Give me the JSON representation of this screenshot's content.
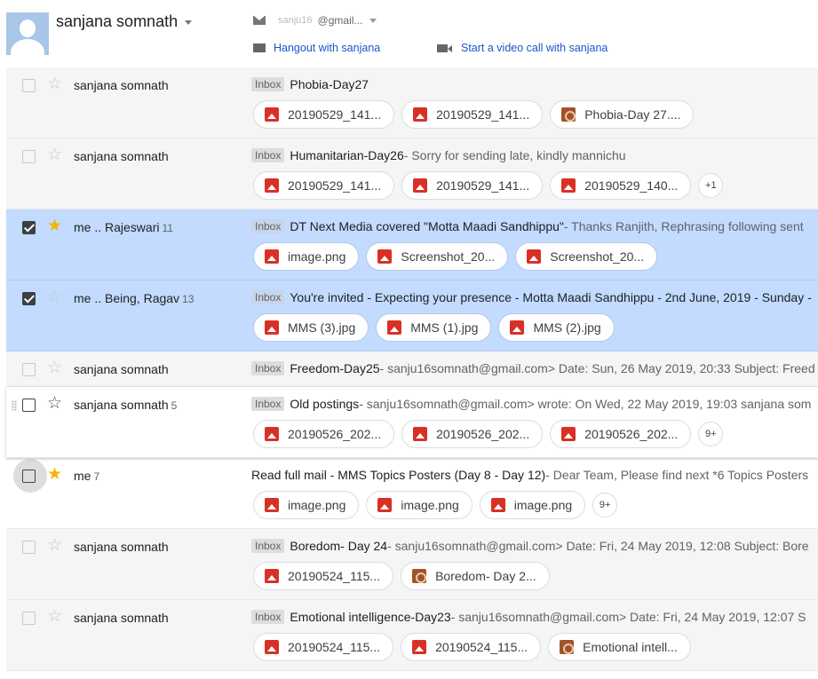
{
  "header": {
    "name": "sanjana somnath",
    "email_masked": "sanju16",
    "email_domain": "@gmail...",
    "hangout": "Hangout with sanjana",
    "video": "Start a video call with sanjana"
  },
  "rows": [
    {
      "sender": "sanjana somnath",
      "count": "",
      "label": "Inbox",
      "subject": "Phobia-Day27",
      "snippet": "",
      "chips": [
        "20190529_141...",
        "20190529_141...",
        "Phobia-Day 27...."
      ],
      "more": ""
    },
    {
      "sender": "sanjana somnath",
      "count": "",
      "label": "Inbox",
      "subject": "Humanitarian-Day26",
      "snippet": " - Sorry for sending late, kindly mannichu",
      "chips": [
        "20190529_141...",
        "20190529_141...",
        "20190529_140..."
      ],
      "more": "+1"
    },
    {
      "sender": "me .. Rajeswari",
      "count": "11",
      "label": "Inbox",
      "subject": "DT Next Media covered \"Motta Maadi Sandhippu\"",
      "snippet": " - Thanks Ranjith, Rephrasing following sent",
      "chips": [
        "image.png",
        "Screenshot_20...",
        "Screenshot_20..."
      ],
      "more": ""
    },
    {
      "sender": "me .. Being, Ragav",
      "count": "13",
      "label": "Inbox",
      "subject": "You're invited - Expecting your presence - Motta Maadi Sandhippu - 2nd June, 2019 - Sunday -",
      "snippet": "",
      "chips": [
        "MMS (3).jpg",
        "MMS (1).jpg",
        "MMS (2).jpg"
      ],
      "more": ""
    },
    {
      "sender": "sanjana somnath",
      "count": "",
      "label": "Inbox",
      "subject": "Freedom-Day25",
      "snippet": " - sanju16somnath@gmail.com> Date: Sun, 26 May 2019, 20:33 Subject: Freed",
      "chips": [],
      "more": ""
    },
    {
      "sender": "sanjana somnath",
      "count": "5",
      "label": "Inbox",
      "subject": "Old postings",
      "snippet": " - sanju16somnath@gmail.com> wrote: On Wed, 22 May 2019, 19:03 sanjana som",
      "chips": [
        "20190526_202...",
        "20190526_202...",
        "20190526_202..."
      ],
      "more": "9+"
    },
    {
      "sender": "me",
      "count": "7",
      "label": "",
      "subject": "Read full mail - MMS Topics Posters (Day 8 - Day 12)",
      "snippet": " - Dear Team, Please find next *6 Topics Posters",
      "chips": [
        "image.png",
        "image.png",
        "image.png"
      ],
      "more": "9+"
    },
    {
      "sender": "sanjana somnath",
      "count": "",
      "label": "Inbox",
      "subject": "Boredom- Day 24",
      "snippet": " - sanju16somnath@gmail.com> Date: Fri, 24 May 2019, 12:08 Subject: Bore",
      "chips": [
        "20190524_115...",
        "Boredom- Day 2..."
      ],
      "more": ""
    },
    {
      "sender": "sanjana somnath",
      "count": "",
      "label": "Inbox",
      "subject": "Emotional intelligence-Day23",
      "snippet": " - sanju16somnath@gmail.com> Date: Fri, 24 May 2019, 12:07 S",
      "chips": [
        "20190524_115...",
        "20190524_115...",
        "Emotional intell..."
      ],
      "more": ""
    }
  ]
}
